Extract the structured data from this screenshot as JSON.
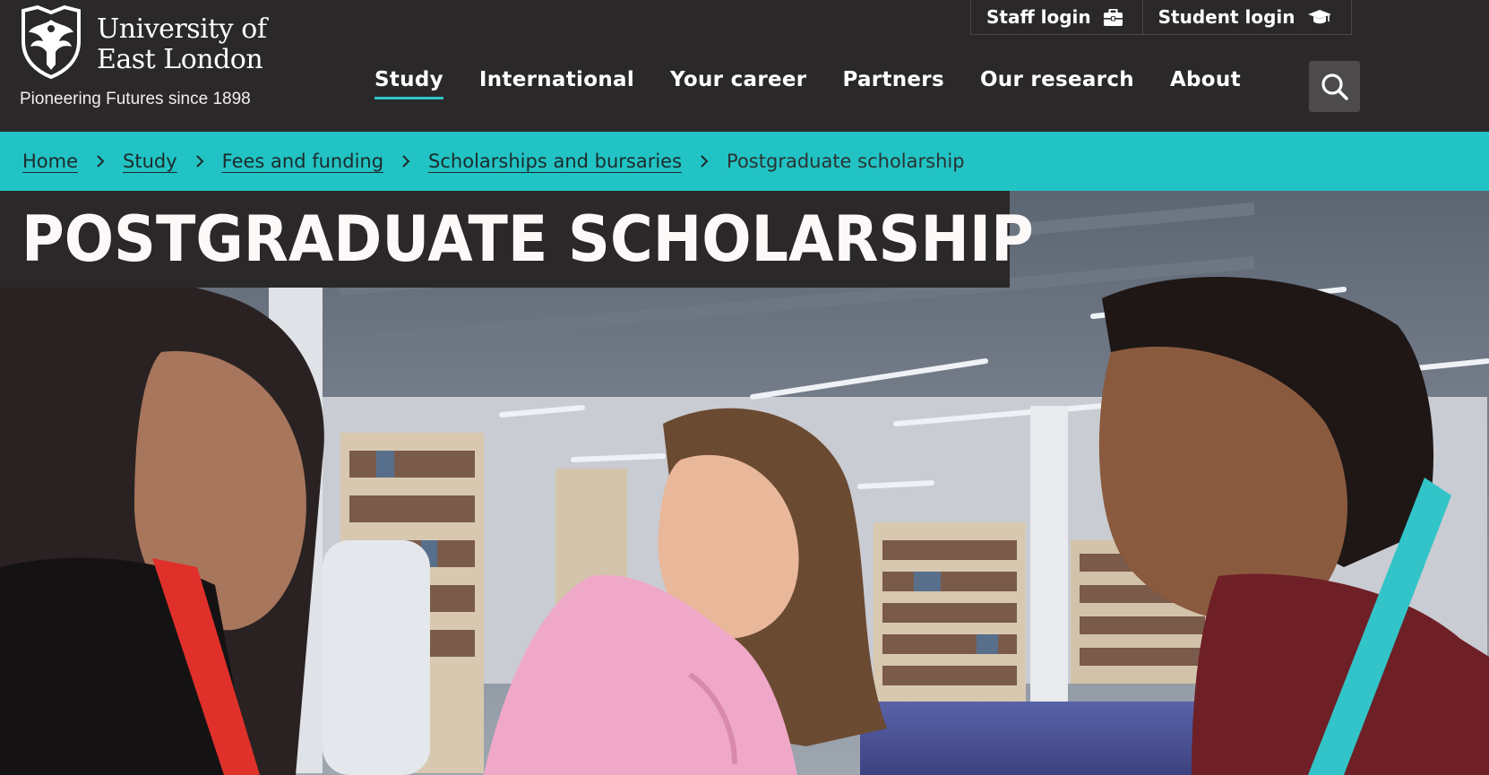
{
  "brand": {
    "name": "University of East London",
    "tagline": "Pioneering Futures since 1898"
  },
  "utility_nav": [
    {
      "label": "Staff login",
      "icon": "briefcase-icon"
    },
    {
      "label": "Student login",
      "icon": "graduation-cap-icon"
    }
  ],
  "main_nav": [
    {
      "label": "Study",
      "active": true
    },
    {
      "label": "International",
      "active": false
    },
    {
      "label": "Your career",
      "active": false
    },
    {
      "label": "Partners",
      "active": false
    },
    {
      "label": "Our research",
      "active": false
    },
    {
      "label": "About",
      "active": false
    }
  ],
  "search": {
    "icon": "search-icon"
  },
  "breadcrumb": {
    "items": [
      "Home",
      "Study",
      "Fees and funding",
      "Scholarships and bursaries"
    ],
    "current": "Postgraduate scholarship",
    "separator_icon": "chevron-right-icon"
  },
  "hero": {
    "title": "POSTGRADUATE SCHOLARSHIP"
  },
  "colors": {
    "header_bg": "#2b2829",
    "accent_teal": "#22c3c4",
    "nav_underline": "#2fc7c9",
    "search_bg": "#4d4a4b"
  }
}
